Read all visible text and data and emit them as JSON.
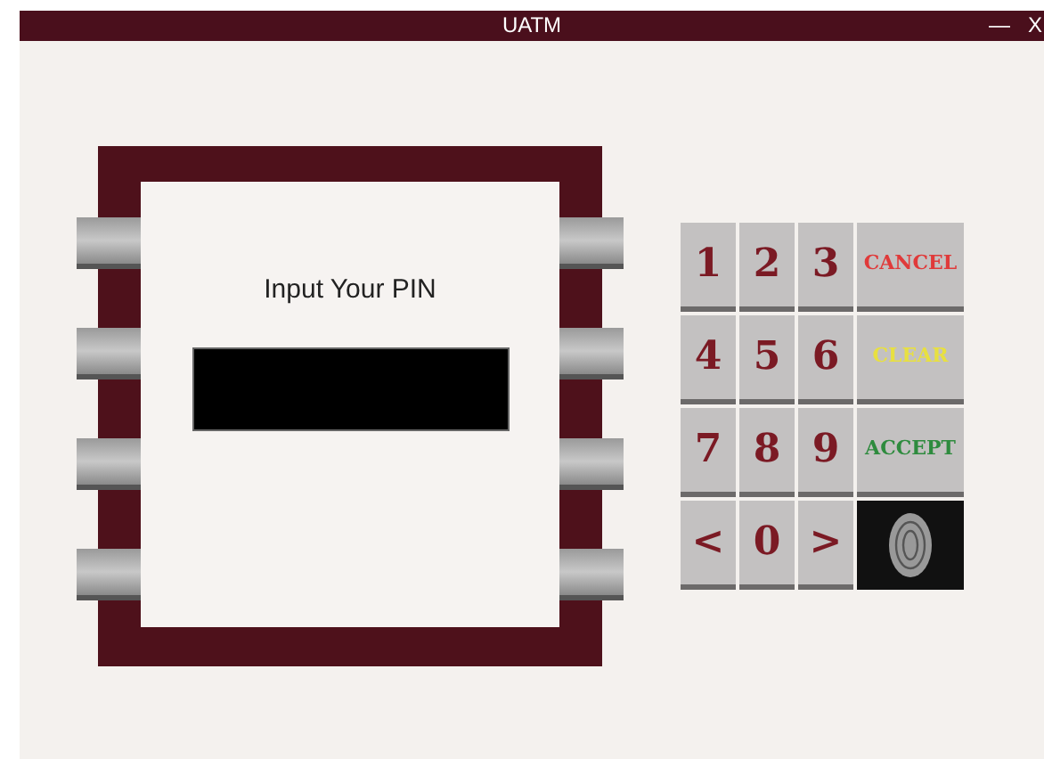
{
  "window": {
    "title": "UATM",
    "controls": [
      "—",
      "X"
    ]
  },
  "screen": {
    "prompt": "Input Your PIN"
  },
  "keypad": [
    {
      "kind": "digit",
      "label": "1"
    },
    {
      "kind": "digit",
      "label": "2"
    },
    {
      "kind": "digit",
      "label": "3"
    },
    {
      "kind": "command",
      "label": "CANCEL",
      "color": "#e03a3a"
    },
    {
      "kind": "digit",
      "label": "4"
    },
    {
      "kind": "digit",
      "label": "5"
    },
    {
      "kind": "digit",
      "label": "6"
    },
    {
      "kind": "command",
      "label": "CLEAR",
      "color": "#e8e040"
    },
    {
      "kind": "digit",
      "label": "7"
    },
    {
      "kind": "digit",
      "label": "8"
    },
    {
      "kind": "digit",
      "label": "9"
    },
    {
      "kind": "command",
      "label": "ACCEPT",
      "color": "#2e8b3e"
    },
    {
      "kind": "digit",
      "label": "<"
    },
    {
      "kind": "digit",
      "label": "0"
    },
    {
      "kind": "digit",
      "label": ">"
    },
    {
      "kind": "fingerprint"
    }
  ]
}
